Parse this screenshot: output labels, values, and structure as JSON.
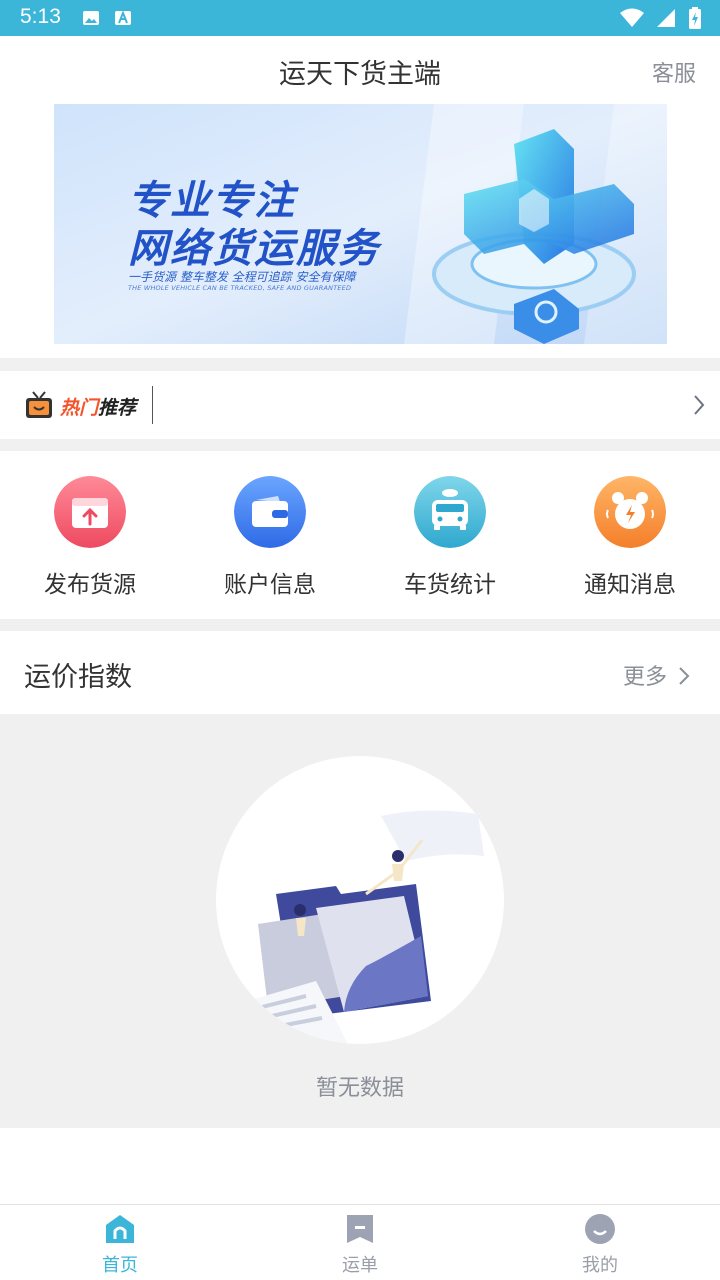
{
  "status_bar": {
    "time": "5:13"
  },
  "header": {
    "title": "运天下货主端",
    "service_label": "客服"
  },
  "banner": {
    "line1": "专业专注",
    "line2": "网络货运服务",
    "subtitle": "一手货源 整车整发 全程可追踪 安全有保障",
    "subtitle_en": "THE WHOLE VEHICLE CAN BE TRACKED, SAFE AND GUARANTEED"
  },
  "hot": {
    "label_part1": "热门",
    "label_part2": "推荐"
  },
  "quick_actions": [
    {
      "label": "发布货源",
      "icon": "publish-cargo-icon",
      "color": "#f0576a"
    },
    {
      "label": "账户信息",
      "icon": "wallet-icon",
      "color": "#3d7cf0"
    },
    {
      "label": "车货统计",
      "icon": "truck-stats-icon",
      "color": "#3bb6d9"
    },
    {
      "label": "通知消息",
      "icon": "alarm-clock-icon",
      "color": "#f6903a"
    }
  ],
  "freight_index": {
    "title": "运价指数",
    "more_label": "更多",
    "empty_text": "暂无数据"
  },
  "tabs": [
    {
      "label": "首页",
      "icon": "home-icon",
      "active": true
    },
    {
      "label": "运单",
      "icon": "waybill-icon",
      "active": false
    },
    {
      "label": "我的",
      "icon": "profile-icon",
      "active": false
    }
  ],
  "colors": {
    "accent": "#3bb6d9",
    "text_secondary": "#8a8f98",
    "divider_bg": "#f0f0f0"
  }
}
